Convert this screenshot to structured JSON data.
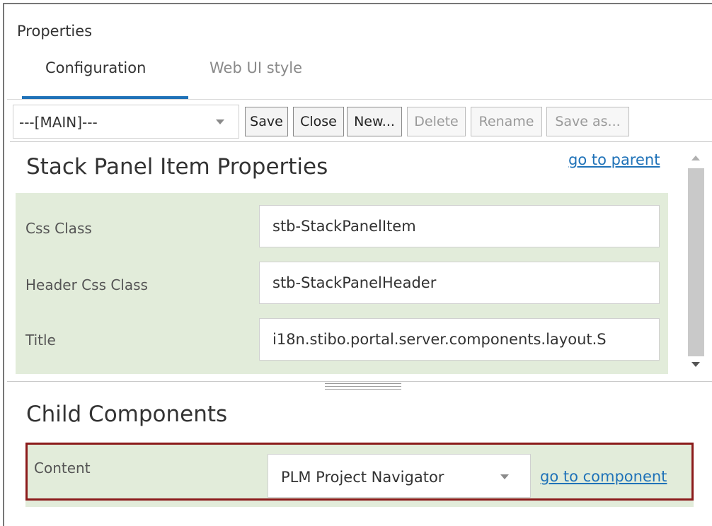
{
  "panel": {
    "title": "Properties"
  },
  "tabs": [
    {
      "label": "Configuration",
      "active": true
    },
    {
      "label": "Web UI style",
      "active": false
    }
  ],
  "toolbar": {
    "config_select": "---[MAIN]---",
    "buttons": [
      {
        "label": "Save",
        "enabled": true
      },
      {
        "label": "Close",
        "enabled": true
      },
      {
        "label": "New...",
        "enabled": true
      },
      {
        "label": "Delete",
        "enabled": false
      },
      {
        "label": "Rename",
        "enabled": false
      },
      {
        "label": "Save as...",
        "enabled": false
      }
    ]
  },
  "properties": {
    "heading": "Stack Panel Item Properties",
    "go_to_parent": "go to parent",
    "fields": [
      {
        "label": "Css Class",
        "value": "stb-StackPanelItem"
      },
      {
        "label": "Header Css Class",
        "value": "stb-StackPanelHeader"
      },
      {
        "label": "Title",
        "value": "i18n.stibo.portal.server.components.layout.S"
      }
    ]
  },
  "child_components": {
    "heading": "Child Components",
    "items": [
      {
        "label": "Content",
        "value": "PLM Project Navigator",
        "link": "go to component"
      }
    ]
  },
  "colors": {
    "accent": "#1f72b8",
    "section_bg": "#e2ecda",
    "highlight_border": "#8b1a1a"
  }
}
